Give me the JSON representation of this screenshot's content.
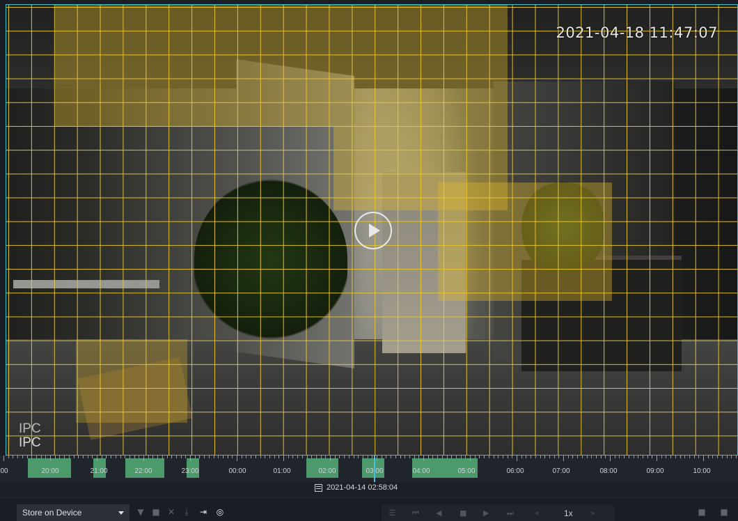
{
  "video": {
    "timestamp": "2021-04-18 11:47:07",
    "osd_line1": "IPC",
    "osd_line2": "IPC",
    "play_button": "play-icon",
    "motion_zone_color": "#e0b829"
  },
  "timeline": {
    "labels": [
      "00",
      "20:00",
      "21:00",
      "22:00",
      "23:00",
      "00:00",
      "01:00",
      "02:00",
      "03:00",
      "04:00",
      "05:00",
      "06:00",
      "07:00",
      "08:00",
      "09:00",
      "10:00"
    ],
    "record_color": "#4c9a6c",
    "cursor_color": "#49c1e6",
    "current_datetime": "2021-04-14 02:58:04"
  },
  "toolbar": {
    "storage_option": "Store on Device",
    "icons": [
      "filter-icon",
      "lock-icon",
      "scissors-icon",
      "download-icon",
      "export-icon",
      "search-target-icon"
    ],
    "playback_icons": [
      "list-icon",
      "skip-start-icon",
      "step-back-icon",
      "stop-icon",
      "play-icon",
      "skip-end-icon",
      "slow-icon",
      "fast-icon"
    ],
    "speed": "1x",
    "right_icons": [
      "lock-icon",
      "lock-icon"
    ]
  }
}
